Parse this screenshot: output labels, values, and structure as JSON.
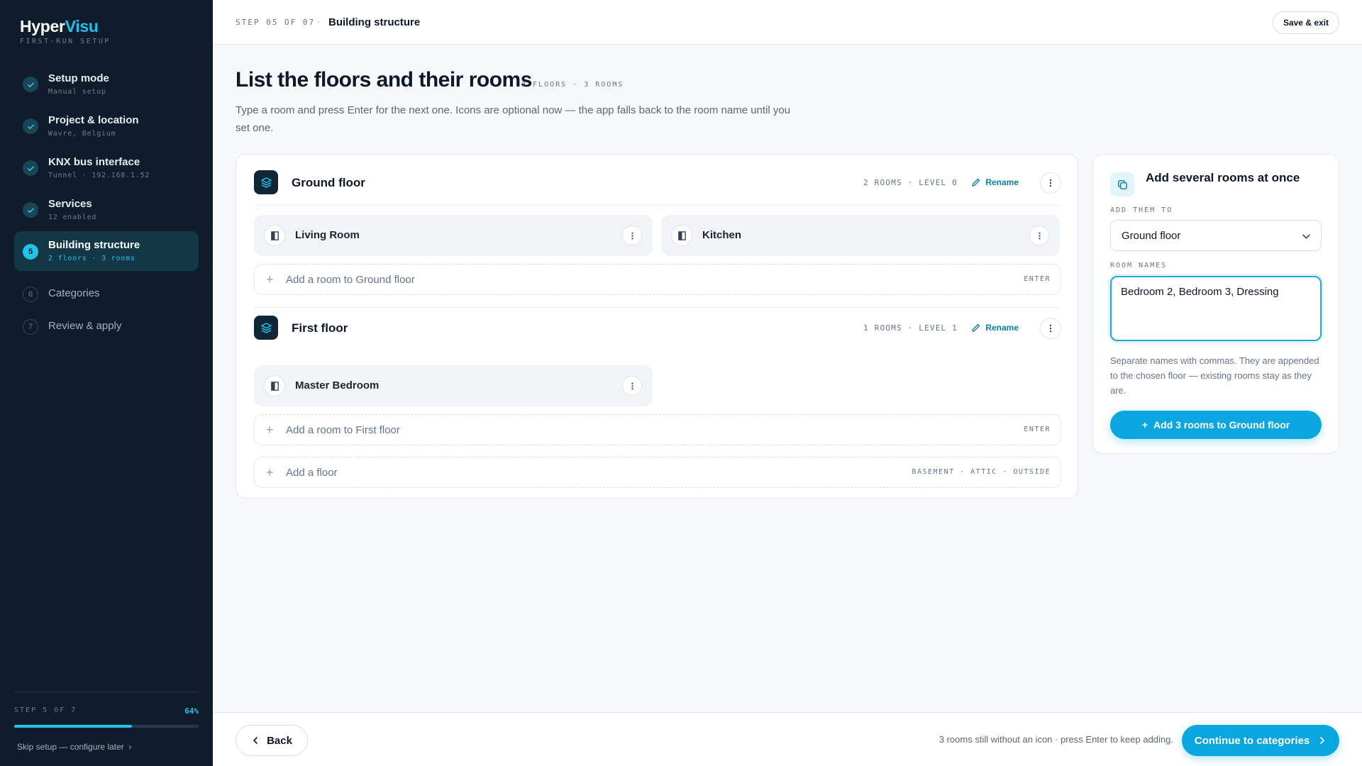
{
  "brand": {
    "name_main": "Hyper",
    "name_accent": "Visu",
    "subtitle": "FIRST-RUN SETUP"
  },
  "sidebar": {
    "steps": [
      {
        "title": "Setup mode",
        "sub": "Manual setup",
        "state": "done"
      },
      {
        "title": "Project & location",
        "sub": "Wavre, Belgium",
        "state": "done"
      },
      {
        "title": "KNX bus interface",
        "sub": "Tunnel · 192.168.1.52",
        "state": "done"
      },
      {
        "title": "Services",
        "sub": "12 enabled",
        "state": "done"
      },
      {
        "number": "5",
        "title": "Building structure",
        "sub": "2 floors · 3 rooms",
        "state": "current"
      },
      {
        "number": "6",
        "title": "Categories",
        "state": "todo"
      },
      {
        "number": "7",
        "title": "Review & apply",
        "state": "todo"
      }
    ],
    "footer": {
      "step_label": "STEP 5 OF 7",
      "percent_label": "64%",
      "progress": 0.64,
      "skip_label": "Skip setup — configure later"
    }
  },
  "topbar": {
    "step": "STEP 05 OF 07",
    "separator": "·",
    "title": "Building structure",
    "save_label": "Save & exit"
  },
  "header": {
    "title": "List the floors and their rooms",
    "meta": "2 FLOORS · 3 ROOMS",
    "description": "Type a room and press Enter for the next one. Icons are optional now — the app falls back to the room name until you set one."
  },
  "floors": [
    {
      "name": "Ground floor",
      "meta": "2 ROOMS · LEVEL 0",
      "rename_label": "Rename",
      "rooms": [
        "Living Room",
        "Kitchen"
      ],
      "add_placeholder": "Add a room to Ground floor",
      "add_hint": "ENTER"
    },
    {
      "name": "First floor",
      "meta": "1 ROOMS · LEVEL 1",
      "rename_label": "Rename",
      "rooms": [
        "Master Bedroom"
      ],
      "add_placeholder": "Add a room to First floor",
      "add_hint": "ENTER"
    }
  ],
  "add_floor": {
    "label": "Add a floor",
    "hint": "BASEMENT · ATTIC · OUTSIDE"
  },
  "bulk": {
    "title": "Add several rooms at once",
    "target_label": "ADD THEM TO",
    "target_value": "Ground floor",
    "names_label": "ROOM NAMES",
    "names_value": "Bedroom 2, Bedroom 3, Dressing",
    "help": "Separate names with commas. They are appended to the chosen floor — existing rooms stay as they are.",
    "button_label": "Add 3 rooms to Ground floor"
  },
  "footer": {
    "back_label": "Back",
    "note": "3 rooms still without an icon · press Enter to keep adding.",
    "continue_label": "Continue to categories"
  },
  "colors": {
    "accent": "#22c3ea",
    "primary_button": "#0aa6e0",
    "sidebar_bg": "#0f1c2b",
    "link": "#0a7fa6"
  }
}
